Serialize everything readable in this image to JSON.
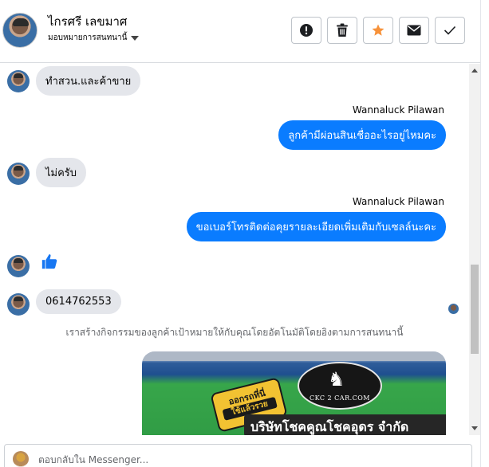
{
  "contact": {
    "name": "ไกรศรี เลขมาศ",
    "assign_label": "มอบหมายการสนทนานี้"
  },
  "actions": [
    {
      "id": "mark-spam",
      "icon": "exclamation-circle-icon"
    },
    {
      "id": "delete",
      "icon": "trash-icon"
    },
    {
      "id": "star",
      "icon": "star-icon"
    },
    {
      "id": "mark-unread",
      "icon": "envelope-icon"
    },
    {
      "id": "mark-done",
      "icon": "check-icon"
    }
  ],
  "messages": {
    "m1": {
      "direction": "in",
      "text": "ทำสวน.และค้าขาย"
    },
    "m2_sender": "Wannaluck Pilawan",
    "m2": {
      "direction": "out",
      "text": "ลูกค้ามีผ่อนสินเชื่ออะไรอยู่ไหมคะ"
    },
    "m3": {
      "direction": "in",
      "text": "ไม่ครับ"
    },
    "m4_sender": "Wannaluck Pilawan",
    "m4": {
      "direction": "out",
      "text": "ขอเบอร์โทรติดต่อคุยรายละเอียดเพิ่มเติมกับเซลล์นะคะ"
    },
    "m5": {
      "direction": "in",
      "type": "like-sticker",
      "icon": "thumbs-up-icon"
    },
    "m6": {
      "direction": "in",
      "text": "0614762553"
    }
  },
  "system_note": "เราสร้างกิจกรรมของลูกค้าเป้าหมายให้กับคุณโดยอัตโนมัติโดยอิงตามการสนทนานี้",
  "ad": {
    "logo_text": "CKC 2 CAR.COM",
    "badge_line1": "ออกรถที่นี่",
    "badge_line2": "ใช้แล้วรวย",
    "company": "บริษัทโชคคูณโชคอุดร จำกัด"
  },
  "composer": {
    "placeholder": "ตอบกลับใน Messenger..."
  },
  "colors": {
    "outgoing_bubble": "#0a7cff",
    "incoming_bubble": "#e4e6eb",
    "star_accent": "#f7923a",
    "like_blue": "#1877f2"
  }
}
